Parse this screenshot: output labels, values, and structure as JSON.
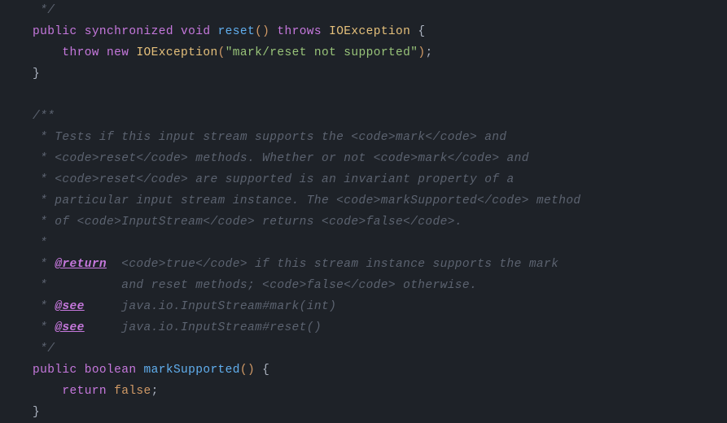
{
  "code": {
    "l0": " */",
    "l1_kw1": "public",
    "l1_kw2": "synchronized",
    "l1_kw3": "void",
    "l1_method": "reset",
    "l1_paren": "()",
    "l1_throws": "throws",
    "l1_type": "IOException",
    "l1_brace": " {",
    "l2_throw": "throw",
    "l2_new": "new",
    "l2_type": "IOException",
    "l2_open": "(",
    "l2_str": "\"mark/reset not supported\"",
    "l2_close": ")",
    "l2_semi": ";",
    "l3": "}",
    "d0": "/**",
    "d1a": " * Tests if this input stream supports the ",
    "d1b": "<code>",
    "d1c": "mark",
    "d1d": "</code>",
    "d1e": " and",
    "d2a": " * ",
    "d2b": "<code>",
    "d2c": "reset",
    "d2d": "</code>",
    "d2e": " methods. Whether or not ",
    "d2f": "<code>",
    "d2g": "mark",
    "d2h": "</code>",
    "d2i": " and",
    "d3a": " * ",
    "d3b": "<code>",
    "d3c": "reset",
    "d3d": "</code>",
    "d3e": " are supported is an invariant property of a",
    "d4a": " * particular input stream instance. The ",
    "d4b": "<code>",
    "d4c": "markSupported",
    "d4d": "</code>",
    "d4e": " method",
    "d5a": " * of ",
    "d5b": "<code>",
    "d5c": "InputStream",
    "d5d": "</code>",
    "d5e": " returns ",
    "d5f": "<code>",
    "d5g": "false",
    "d5h": "</code>",
    "d5i": ".",
    "d6": " *",
    "d7a": " * ",
    "d7tag": "@return",
    "d7b": "  ",
    "d7c": "<code>",
    "d7d": "true",
    "d7e": "</code>",
    "d7f": " if this stream instance supports the mark",
    "d8a": " *          and reset methods; ",
    "d8b": "<code>",
    "d8c": "false",
    "d8d": "</code>",
    "d8e": " otherwise.",
    "d9a": " * ",
    "d9tag": "@see",
    "d9b": "     java.io.InputStream",
    "d9c": "#mark(int)",
    "d10a": " * ",
    "d10tag": "@see",
    "d10b": "     java.io.InputStream",
    "d10c": "#reset()",
    "d11": " */",
    "m1_kw1": "public",
    "m1_kw2": "boolean",
    "m1_method": "markSupported",
    "m1_paren": "()",
    "m1_brace": " {",
    "m2_return": "return",
    "m2_false": "false",
    "m2_semi": ";",
    "m3": "}"
  }
}
